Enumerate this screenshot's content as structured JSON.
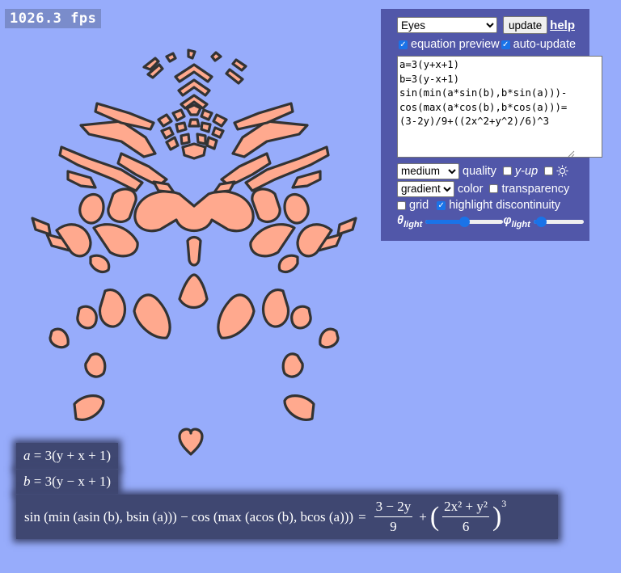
{
  "fps": "1026.3 fps",
  "panel": {
    "preset": {
      "selected": "Eyes"
    },
    "update_label": "update",
    "help_label": "help",
    "equation_preview": {
      "label": "equation preview",
      "checked": true
    },
    "auto_update": {
      "label": "auto-update",
      "checked": true
    },
    "equation_text": "a=3(y+x+1)\nb=3(y-x+1)\nsin(min(a*sin(b),b*sin(a)))-\ncos(max(a*cos(b),b*cos(a)))=\n(3-2y)/9+((2x^2+y^2)/6)^3",
    "quality": {
      "selected": "medium",
      "label": "quality"
    },
    "y_up": {
      "label": "y-up",
      "checked": false
    },
    "sun_toggle": {
      "checked": false,
      "icon": "sun-icon"
    },
    "color": {
      "selected": "gradient",
      "label": "color"
    },
    "transparency": {
      "label": "transparency",
      "checked": false
    },
    "grid": {
      "label": "grid",
      "checked": false
    },
    "highlight_discontinuity": {
      "label": "highlight discontinuity",
      "checked": true
    },
    "theta_light": {
      "symbol": "θ",
      "sub": "light",
      "value": 0.5
    },
    "phi_light": {
      "symbol": "φ",
      "sub": "light",
      "value": 0.1
    }
  },
  "preview": {
    "line1_lhs": "a",
    "line1_rhs": "3(y + x + 1)",
    "line2_lhs": "b",
    "line2_rhs": "3(y − x + 1)",
    "line3_lhs": "sin (min (asin (b), bsin (a))) − cos (max (acos (b), bcos (a)))",
    "frac1_num": "3 − 2y",
    "frac1_den": "9",
    "frac2_num": "2x² + y²",
    "frac2_den": "6",
    "exponent": "3"
  },
  "colors": {
    "background": "#97acfb",
    "panel": "#5157a9",
    "shape_fill": "#ffa98e",
    "shape_stroke": "#333333",
    "accent": "#1a73e8"
  }
}
